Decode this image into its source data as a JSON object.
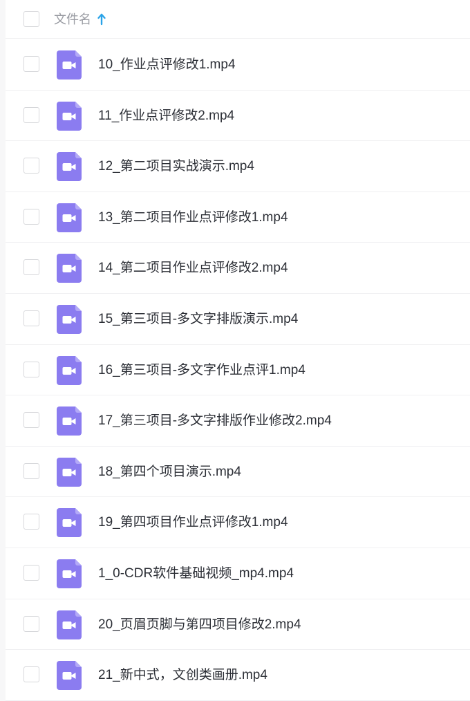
{
  "header": {
    "column_label": "文件名",
    "sort_icon": "arrow-up-icon"
  },
  "files": [
    {
      "name": "10_作业点评修改1.mp4",
      "icon": "video-file-icon"
    },
    {
      "name": "11_作业点评修改2.mp4",
      "icon": "video-file-icon"
    },
    {
      "name": "12_第二项目实战演示.mp4",
      "icon": "video-file-icon"
    },
    {
      "name": "13_第二项目作业点评修改1.mp4",
      "icon": "video-file-icon"
    },
    {
      "name": "14_第二项目作业点评修改2.mp4",
      "icon": "video-file-icon"
    },
    {
      "name": "15_第三项目-多文字排版演示.mp4",
      "icon": "video-file-icon"
    },
    {
      "name": "16_第三项目-多文字作业点评1.mp4",
      "icon": "video-file-icon"
    },
    {
      "name": "17_第三项目-多文字排版作业修改2.mp4",
      "icon": "video-file-icon"
    },
    {
      "name": "18_第四个项目演示.mp4",
      "icon": "video-file-icon"
    },
    {
      "name": "19_第四项目作业点评修改1.mp4",
      "icon": "video-file-icon"
    },
    {
      "name": "1_0-CDR软件基础视频_mp4.mp4",
      "icon": "video-file-icon"
    },
    {
      "name": "20_页眉页脚与第四项目修改2.mp4",
      "icon": "video-file-icon"
    },
    {
      "name": "21_新中式，文创类画册.mp4",
      "icon": "video-file-icon"
    }
  ],
  "colors": {
    "icon_purple": "#8b7cf0",
    "sort_blue": "#2aa3e8",
    "text": "#2c2f36",
    "header_text": "#9a9ca3"
  }
}
